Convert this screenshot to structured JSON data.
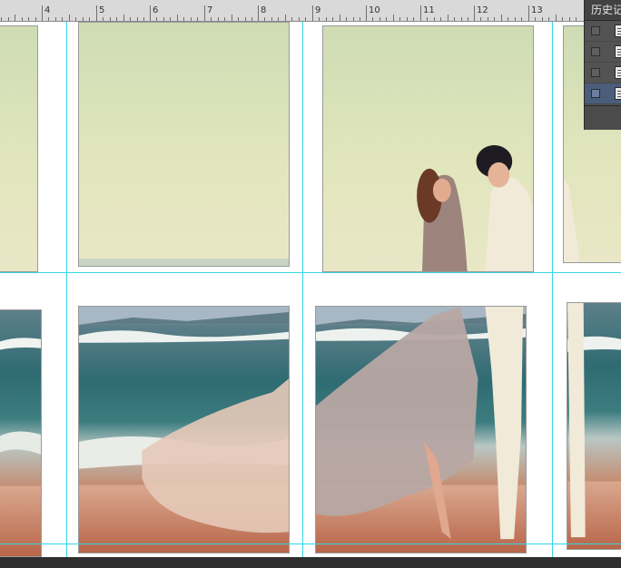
{
  "ruler": {
    "labels": [
      "4",
      "5",
      "6",
      "7",
      "8",
      "9",
      "10",
      "11",
      "12",
      "13"
    ]
  },
  "history_panel": {
    "title": "历史记",
    "rows": [
      {
        "selected": false,
        "icon": "document-snapshot-icon"
      },
      {
        "selected": false,
        "icon": "document-snapshot-icon"
      },
      {
        "selected": false,
        "icon": "document-snapshot-icon"
      },
      {
        "selected": true,
        "icon": "document-snapshot-icon"
      }
    ]
  },
  "colors": {
    "guide": "#33d6e6",
    "ruler_bg": "#d9d9d9",
    "panel_bg": "#535353",
    "selection": "#4a5e7c"
  },
  "canvas": {
    "content": "photo collage of couple on beach, split into 8 tiles"
  }
}
